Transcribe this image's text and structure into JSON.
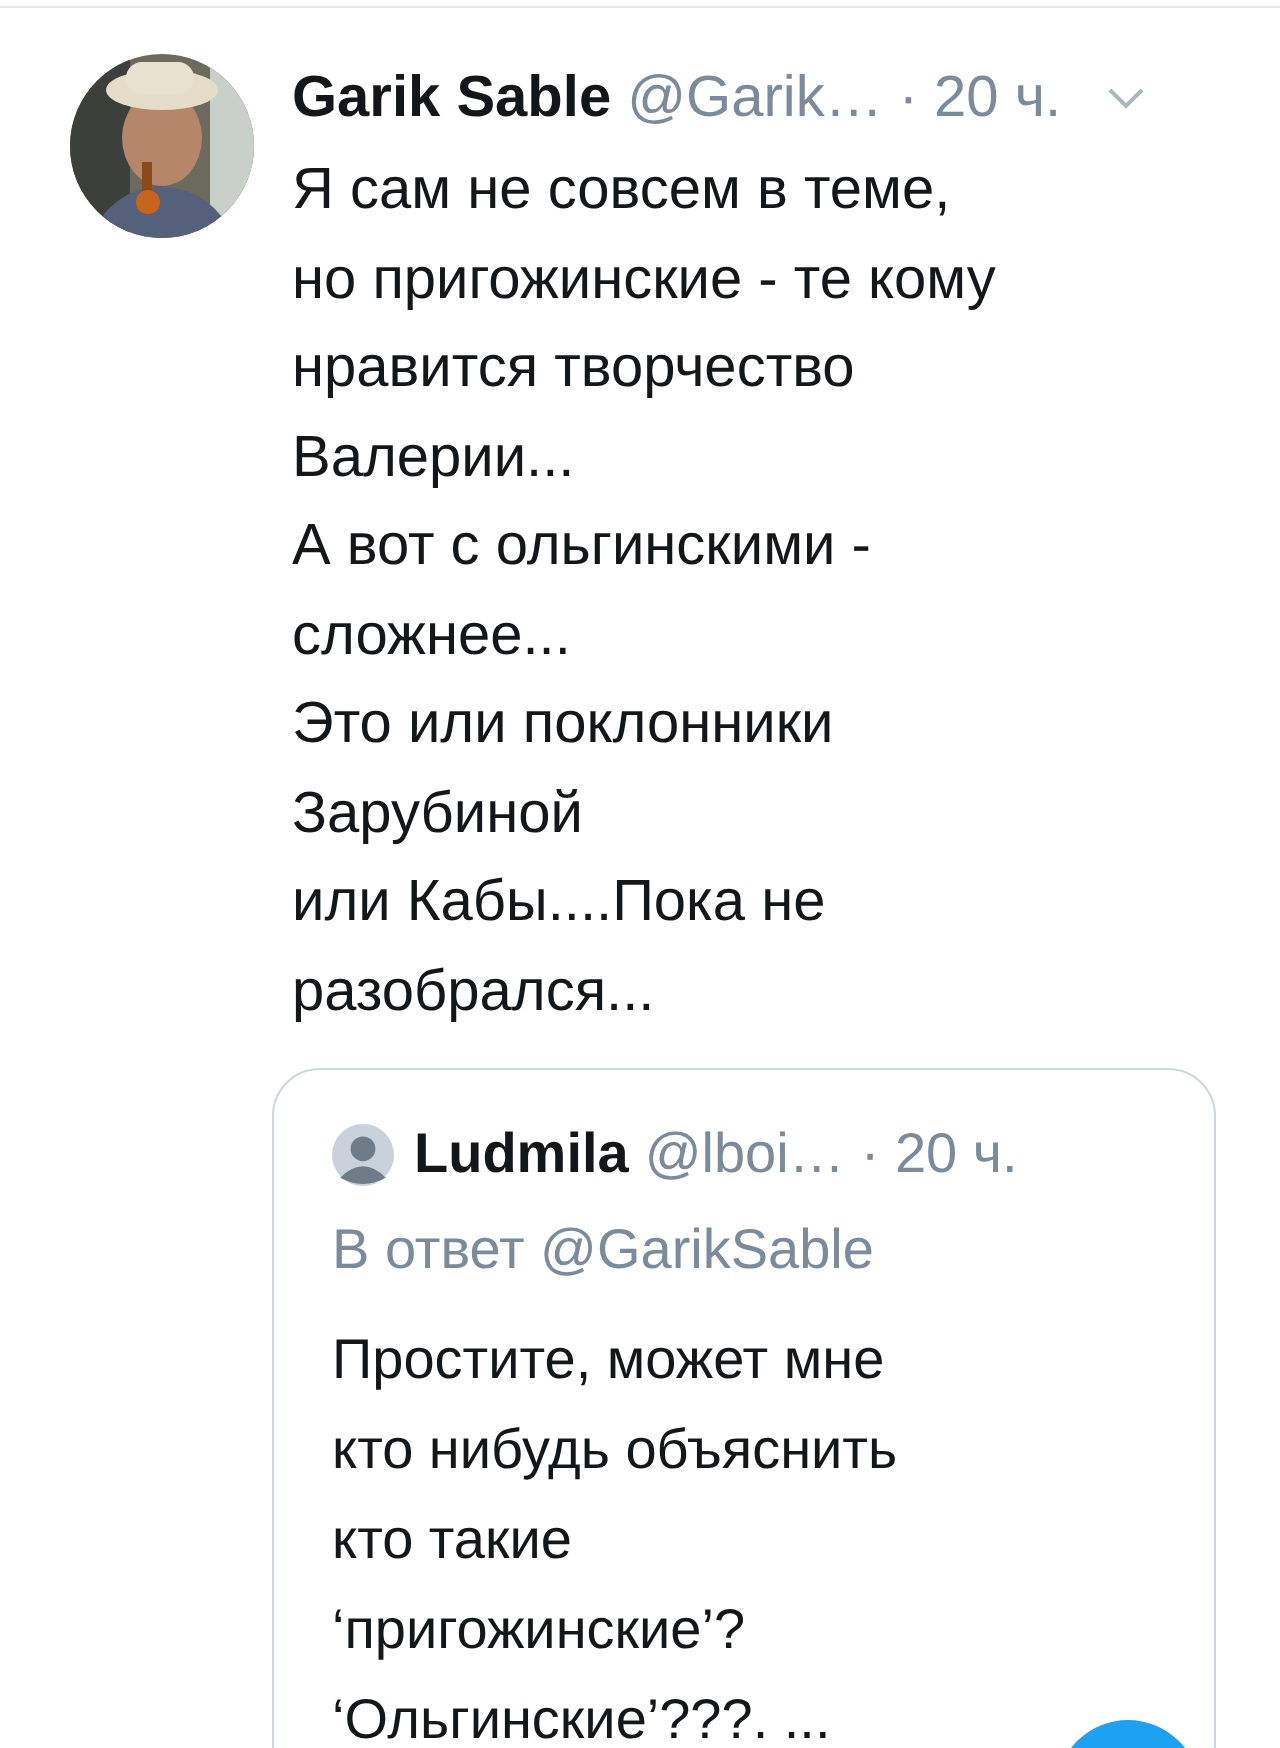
{
  "tweet": {
    "author": "Garik Sable",
    "handle": "@Garik…",
    "time": "· 20 ч.",
    "text": "Я сам не совсем в теме,\nно пригожинские - те кому\nнравится творчество\nВалерии...\nА вот с ольгинскими -\nсложнее...\nЭто или поклонники\nЗарубиной\nили Кабы....Пока не\nразобрался..."
  },
  "quoted": {
    "author": "Ludmila",
    "handle": "@lboi…",
    "time": "· 20 ч.",
    "reply_to": "В ответ @GarikSable",
    "text": "Простите, может мне\nкто нибудь объяснить\nкто такие\n‘пригожинские’?\n‘Ольгинские’???. ..."
  }
}
